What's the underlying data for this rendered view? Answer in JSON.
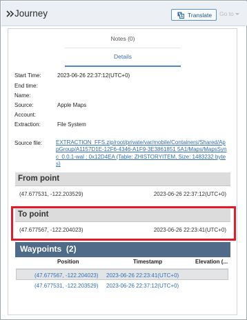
{
  "header": {
    "title": "Journey",
    "translate_label": "Translate",
    "goto_label": "Go to"
  },
  "tabs": {
    "notes": "Notes (0)",
    "details": "Details"
  },
  "fields": [
    {
      "label": "Start Time:",
      "value": "2023-06-26 22:37:12(UTC+0)"
    },
    {
      "label": "End time:",
      "value": ""
    },
    {
      "label": "Name:",
      "value": ""
    },
    {
      "label": "Source:",
      "value": "Apple Maps"
    },
    {
      "label": "Account:",
      "value": ""
    },
    {
      "label": "Extraction:",
      "value": "File System"
    }
  ],
  "source_file": {
    "label": "Source file:",
    "link": "EXTRACTION_FFS.zip/root/private/var/mobile/Containers/Shared/AppGroup/A1157D1E-12F6-4346-A1F9-3E3861851 5A1/Maps/MapsSync_0.0.1-wal : 0x12D4EA (Table: ZHISTORYITEM, Size: 1483232 bytes)"
  },
  "from_point": {
    "title": "From point",
    "coords": "(47.677531, -122.203529)",
    "time": "2023-06-26 22:37:12(UTC+0)"
  },
  "to_point": {
    "title": "To point",
    "coords": "(47.677567, -122.204023)",
    "time": "2023-06-26 22:23:41(UTC+0)"
  },
  "waypoints": {
    "title": "Waypoints",
    "count": "(2)",
    "columns": [
      "Position",
      "Timestamp",
      "Elevation (..."
    ],
    "rows": [
      {
        "position": "(47.677567, -122.204023)",
        "timestamp": "2023-06-26 22:23:41(UTC+0)",
        "elevation": ""
      },
      {
        "position": "(47.677531, -122.203529)",
        "timestamp": "2023-06-26 22:37:12(UTC+0)",
        "elevation": ""
      }
    ]
  },
  "colors": {
    "link": "#2f6fb5",
    "waypoints_header": "#506a89",
    "highlight_border": "#e11b2a",
    "tab_active": "#4a87c6"
  },
  "icons": {
    "title_chevron": "double-chevron-right-icon",
    "translate": "translate-icon",
    "goto": "chevron-down-icon"
  }
}
